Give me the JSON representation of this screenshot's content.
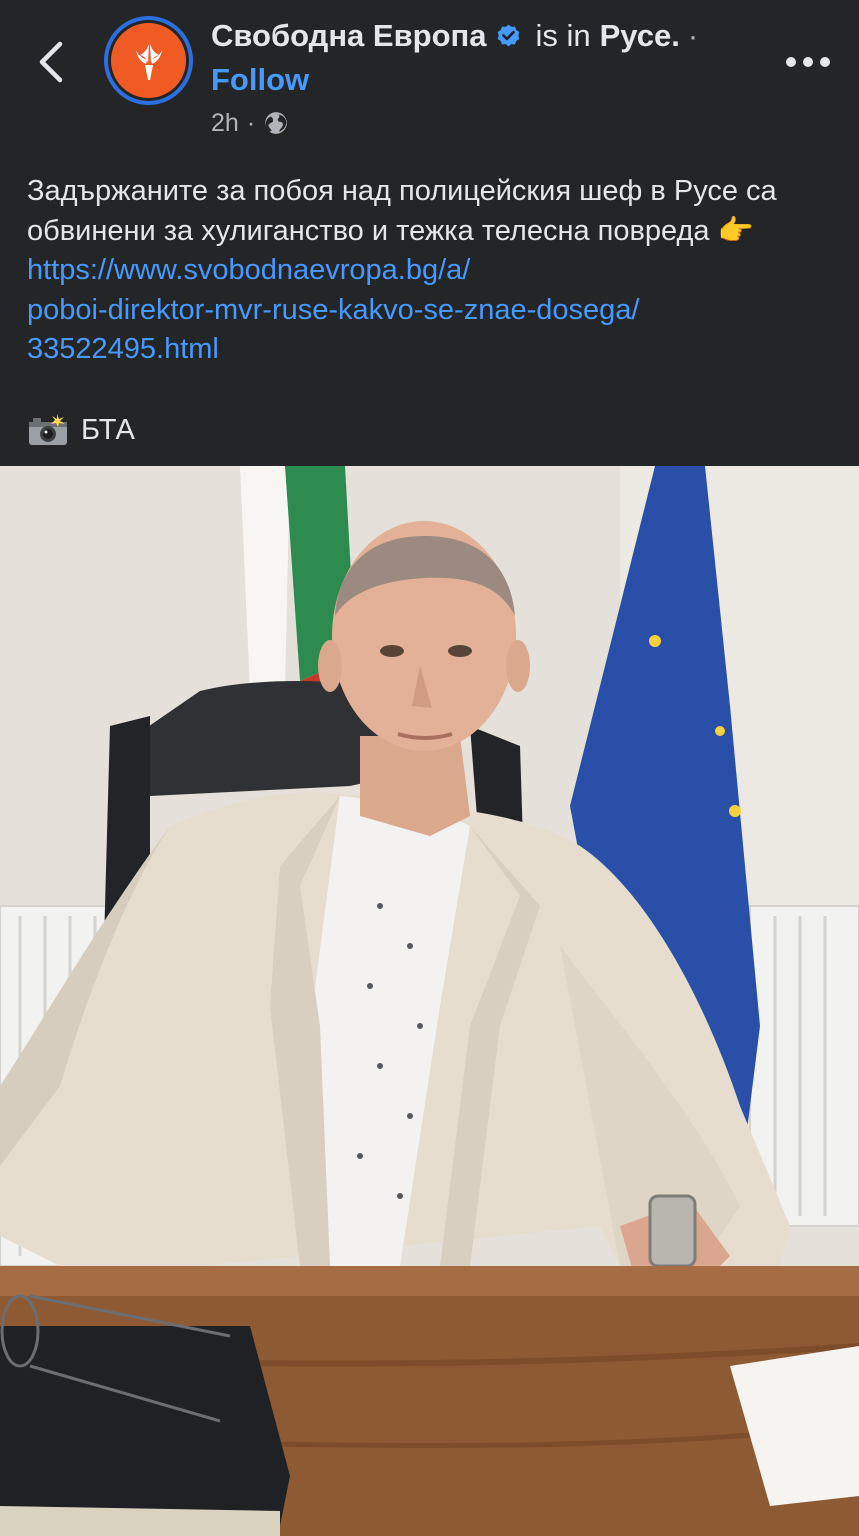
{
  "header": {
    "page_name": "Свободна Европа",
    "is_in": "is in",
    "location": "Русе.",
    "separator": "·",
    "follow_label": "Follow",
    "time": "2h",
    "meta_separator": "·",
    "privacy_icon": "globe-icon",
    "back_icon": "chevron-left-icon",
    "more_icon": "more-horizontal-icon",
    "verified_icon": "verified-badge-icon"
  },
  "post": {
    "text": "Задържаните за побоя над полицейския шеф в Русе са обвинени за хулиганство и тежка телесна повреда",
    "pointing_emoji": "👉",
    "link": "https://www.svobodnaevropa.bg/a/poboi-direktor-mvr-ruse-kakvo-se-znae-dosega/33522495.html",
    "link_line1": "https://www.svobodnaevropa.bg/a/",
    "link_line2": "poboi-direktor-mvr-ruse-kakvo-se-znae-dosega/",
    "link_line3": "33522495.html",
    "credit_icon": "camera-flash-icon",
    "credit": "БТА"
  },
  "photo": {
    "subject": "post-photo"
  },
  "colors": {
    "background": "#242526",
    "text": "#e4e6eb",
    "secondary_text": "#b0b3b8",
    "link": "#4599ff",
    "avatar_ring": "#2d6ee0",
    "avatar_fill": "#ef5b23"
  }
}
